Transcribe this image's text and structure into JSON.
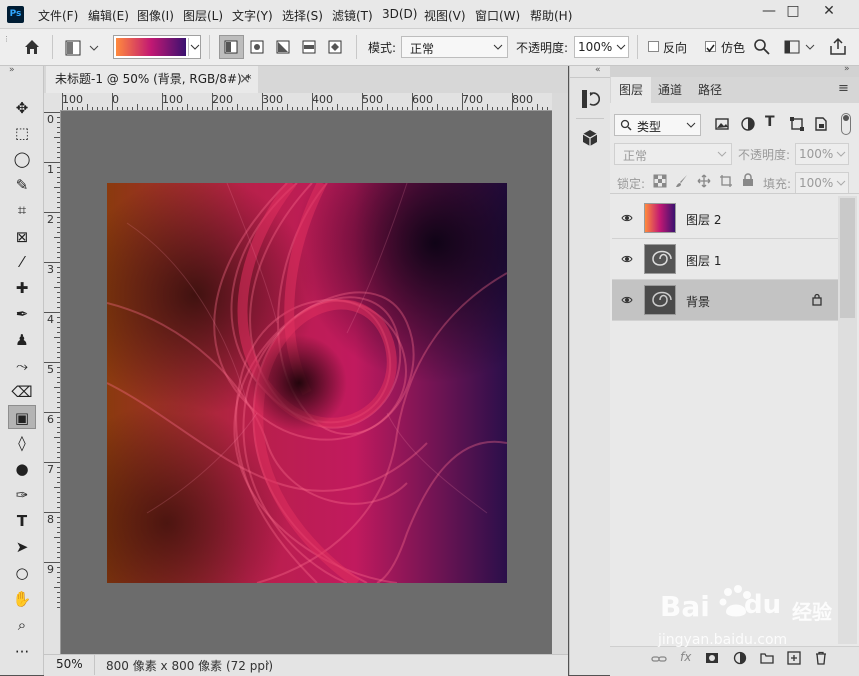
{
  "app": {
    "logo": "Ps",
    "menu": [
      "文件(F)",
      "编辑(E)",
      "图像(I)",
      "图层(L)",
      "文字(Y)",
      "选择(S)",
      "滤镜(T)",
      "3D(D)",
      "视图(V)",
      "窗口(W)",
      "帮助(H)"
    ],
    "window_buttons": [
      "—",
      "□",
      "✕"
    ]
  },
  "options": {
    "home_icon": "home-icon",
    "gradient_colors": [
      "#ff8a3d",
      "#c21873",
      "#3a1170"
    ],
    "mode_label": "模式:",
    "mode_value": "正常",
    "opacity_label": "不透明度:",
    "opacity_value": "100%",
    "reverse_label": "反向",
    "reverse_checked": false,
    "dither_label": "仿色",
    "dither_checked": true
  },
  "tools": [
    "move-tool",
    "marquee-tool",
    "lasso-tool",
    "quick-select-tool",
    "crop-tool",
    "frame-tool",
    "eyedropper-tool",
    "healing-tool",
    "brush-tool",
    "stamp-tool",
    "history-brush-tool",
    "eraser-tool",
    "gradient-tool",
    "blur-tool",
    "dodge-tool",
    "pen-tool",
    "type-tool",
    "path-select-tool",
    "ellipse-tool",
    "hand-tool",
    "zoom-tool",
    "more-tools"
  ],
  "document": {
    "tab_title": "未标题-1 @ 50% (背景, RGB/8#) *",
    "tab_close": "×",
    "ruler_top_numbers": [
      "100",
      "0",
      "100",
      "200",
      "300",
      "400",
      "500",
      "600",
      "700",
      "800"
    ],
    "ruler_left_numbers": [
      "0",
      "1",
      "2",
      "3",
      "4",
      "5",
      "6",
      "7",
      "8",
      "9"
    ],
    "zoom": "50%",
    "status": "800 像素 x 800 像素 (72 ppi)"
  },
  "layers_panel": {
    "tabs": [
      "图层",
      "通道",
      "路径"
    ],
    "active_tab": "图层",
    "filter_label": "类型",
    "blend_mode": "正常",
    "opacity_label": "不透明度:",
    "opacity_value": "100%",
    "lock_label": "锁定:",
    "fill_label": "填充:",
    "fill_value": "100%",
    "layers": [
      {
        "name": "图层 2",
        "selected": false,
        "locked": false
      },
      {
        "name": "图层 1",
        "selected": false,
        "locked": false
      },
      {
        "name": "背景",
        "selected": true,
        "locked": true
      }
    ]
  },
  "watermark": {
    "brand": "Bai",
    "brand2": "du",
    "suffix": "经验",
    "url": "jingyan.baidu.com"
  }
}
